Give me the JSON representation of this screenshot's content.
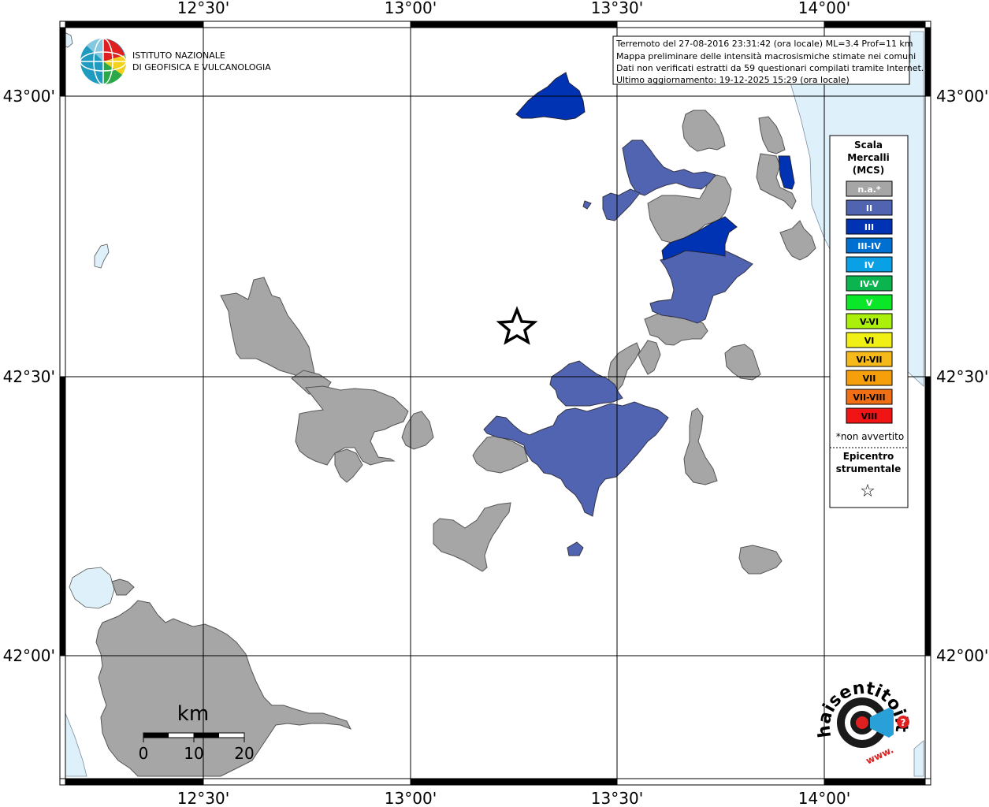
{
  "map": {
    "axis_labels": {
      "top": [
        "12°30'",
        "13°00'",
        "13°30'",
        "14°00'"
      ],
      "bottom": [
        "12°30'",
        "13°00'",
        "13°30'",
        "14°00'"
      ],
      "left": [
        "43°00'",
        "42°30'",
        "42°00'"
      ],
      "right": [
        "43°00'",
        "42°30'",
        "42°00'"
      ]
    },
    "info_lines": [
      "Terremoto del 27-08-2016 23:31:42 (ora locale) ML=3.4 Prof=11 km",
      "Mappa preliminare delle intensità macrosismiche stimate nei comuni",
      "Dati non verificati estratti da 59 questionari compilati tramite Internet.",
      "Ultimo aggiornamento: 19-12-2025 15:29 (ora locale)"
    ],
    "institute_logo": {
      "line1": "ISTITUTO NAZIONALE",
      "line2": "DI GEOFISICA E VULCANOLOGIA"
    },
    "legend": {
      "title_lines": [
        "Scala",
        "Mercalli",
        "(MCS)"
      ],
      "items": [
        {
          "label": "n.a.*",
          "color": "#a6a6a6",
          "text_dark": false
        },
        {
          "label": "II",
          "color": "#5064b2",
          "text_dark": false
        },
        {
          "label": "III",
          "color": "#0032b4",
          "text_dark": false
        },
        {
          "label": "III-IV",
          "color": "#006fd2",
          "text_dark": false
        },
        {
          "label": "IV",
          "color": "#0aa0e6",
          "text_dark": false
        },
        {
          "label": "IV-V",
          "color": "#0cb44f",
          "text_dark": false
        },
        {
          "label": "V",
          "color": "#0ae628",
          "text_dark": false
        },
        {
          "label": "V-VI",
          "color": "#aaf00a",
          "text_dark": true
        },
        {
          "label": "VI",
          "color": "#f0f014",
          "text_dark": true
        },
        {
          "label": "VI-VII",
          "color": "#f5b919",
          "text_dark": true
        },
        {
          "label": "VII",
          "color": "#f5a00a",
          "text_dark": true
        },
        {
          "label": "VII-VIII",
          "color": "#f06e14",
          "text_dark": true
        },
        {
          "label": "VIII",
          "color": "#f01414",
          "text_dark": true
        }
      ],
      "note": "*non avvertito",
      "epicenter_lines": [
        "Epicentro",
        "strumentale"
      ],
      "epicenter_symbol": "☆"
    },
    "scale_bar": {
      "title": "km",
      "ticks": [
        "0",
        "10",
        "20"
      ]
    },
    "brand_logo": {
      "text": "haisentitoilterremoto.it",
      "prefix": "www.",
      "question": "?"
    },
    "colors": {
      "not_felt": "#a6a6a6",
      "intensity_II": "#5064b2",
      "intensity_III": "#0032b4",
      "water": "#def0fa",
      "grid": "#000000"
    }
  }
}
